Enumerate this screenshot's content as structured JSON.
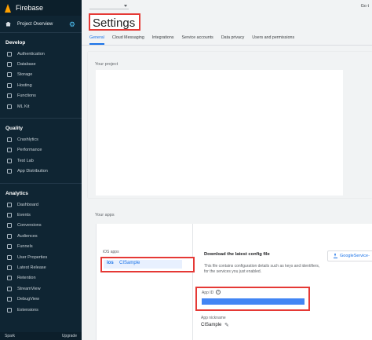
{
  "sidebar": {
    "brand": "Firebase",
    "overview": "Project Overview",
    "sections": [
      {
        "title": "Develop",
        "items": [
          {
            "label": "Authentication",
            "icon": "people-icon"
          },
          {
            "label": "Database",
            "icon": "database-icon"
          },
          {
            "label": "Storage",
            "icon": "storage-icon"
          },
          {
            "label": "Hosting",
            "icon": "globe-icon"
          },
          {
            "label": "Functions",
            "icon": "functions-icon"
          },
          {
            "label": "ML Kit",
            "icon": "robot-icon"
          }
        ]
      },
      {
        "title": "Quality",
        "items": [
          {
            "label": "Crashlytics",
            "icon": "bug-icon"
          },
          {
            "label": "Performance",
            "icon": "speedometer-icon"
          },
          {
            "label": "Test Lab",
            "icon": "checklist-icon"
          },
          {
            "label": "App Distribution",
            "icon": "distribution-icon"
          }
        ]
      },
      {
        "title": "Analytics",
        "items": [
          {
            "label": "Dashboard",
            "icon": "bar-chart-icon"
          },
          {
            "label": "Events",
            "icon": "events-icon"
          },
          {
            "label": "Conversions",
            "icon": "flag-icon"
          },
          {
            "label": "Audiences",
            "icon": "audience-icon"
          },
          {
            "label": "Funnels",
            "icon": "funnel-icon"
          },
          {
            "label": "User Properties",
            "icon": "person-icon"
          },
          {
            "label": "Latest Release",
            "icon": "release-icon"
          },
          {
            "label": "Retention",
            "icon": "retention-icon"
          },
          {
            "label": "StreamView",
            "icon": "stream-icon"
          },
          {
            "label": "DebugView",
            "icon": "debug-icon"
          }
        ]
      }
    ],
    "extensions": "Extensions",
    "plan": "Spark",
    "upgrade": "Upgrade"
  },
  "topbar": {
    "goto": "Go t"
  },
  "page_title": "Settings",
  "tabs": [
    "General",
    "Cloud Messaging",
    "Integrations",
    "Service accounts",
    "Data privacy",
    "Users and permissions"
  ],
  "project_section": {
    "label": "Your project"
  },
  "apps_section": {
    "label": "Your apps",
    "platform": "iOS apps",
    "app": {
      "badge": "ios",
      "nickname": "CISample"
    },
    "download_title": "Download the latest config file",
    "download_desc": "This file contains configuration details such as keys and identifiers, for the services you just enabled.",
    "download_button": "GoogleService-",
    "app_id_label": "App ID",
    "app_id_help": "?",
    "nickname_label": "App nickname",
    "nickname_value": "CISample"
  },
  "colors": {
    "accent": "#1a73e8",
    "highlight": "#e53935",
    "sidebar_bg": "#0f2533",
    "app_id_bar": "#4285f4"
  }
}
